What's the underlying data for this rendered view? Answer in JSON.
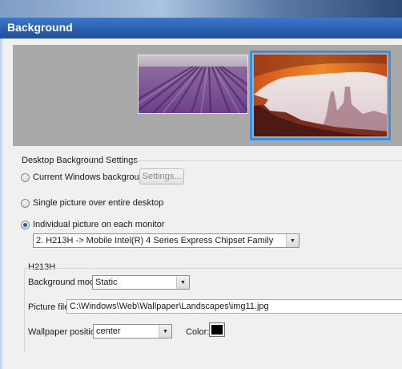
{
  "window": {
    "title": "Background"
  },
  "preview": {
    "monitor1_image": "lavender-field-wallpaper",
    "monitor2_image": "mesa-arch-wallpaper",
    "selected_monitor": 2
  },
  "settings": {
    "group_label": "Desktop Background Settings",
    "option_current": "Current Windows background",
    "settings_button": "Settings...",
    "option_single": "Single picture over entire desktop",
    "option_individual": "Individual picture on each monitor",
    "selected_option": "individual",
    "monitor_select": "2. H213H -> Mobile Intel(R) 4 Series Express Chipset Family"
  },
  "monitor_panel": {
    "group_label": "H213H",
    "background_mode_label": "Background mode:",
    "background_mode_value": "Static",
    "picture_file_label": "Picture file:",
    "picture_file_value": "C:\\Windows\\Web\\Wallpaper\\Landscapes\\img11.jpg",
    "wallpaper_position_label": "Wallpaper position:",
    "wallpaper_position_value": "center",
    "color_label": "Color:",
    "color_value": "#000000"
  }
}
